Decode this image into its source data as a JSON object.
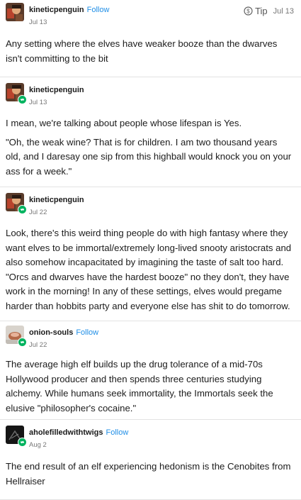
{
  "top_tip": {
    "label": "Tip",
    "date": "Jul 13"
  },
  "posts": [
    {
      "username": "kineticpenguin",
      "follow": "Follow",
      "date": "Jul 13",
      "text": [
        "Any setting where the elves have weaker booze than the dwarves isn't committing to the bit"
      ]
    },
    {
      "username": "kineticpenguin",
      "follow": "",
      "date": "Jul 13",
      "text": [
        "I mean, we're talking about people whose lifespan is Yes.",
        "\"Oh, the weak wine? That is for children. I am two thousand years old, and I daresay one sip from this highball would knock you on your ass for a week.\""
      ]
    },
    {
      "username": "kineticpenguin",
      "follow": "",
      "date": "Jul 22",
      "text": [
        "Look, there's this weird thing people do with high fantasy where they want elves to be immortal/extremely long-lived snooty aristocrats and also somehow incapacitated by imagining the taste of salt too hard. \"Orcs and dwarves have the hardest booze\" no they don't, they have work in the morning! In any of these settings, elves would pregame harder than hobbits party and everyone else has shit to do tomorrow."
      ]
    },
    {
      "username": "onion-souls",
      "follow": "Follow",
      "date": "Jul 22",
      "text": [
        "The average high elf builds up the drug tolerance of a mid-70s Hollywood producer and then spends three centuries studying alchemy. While humans seek immortality, the Immortals seek the elusive \"philosopher's cocaine.\""
      ]
    },
    {
      "username": "aholefilledwithtwigs",
      "follow": "Follow",
      "date": "Aug 2",
      "text": [
        "The end result of an elf experiencing hedonism is the Cenobites from Hellraiser"
      ]
    }
  ]
}
